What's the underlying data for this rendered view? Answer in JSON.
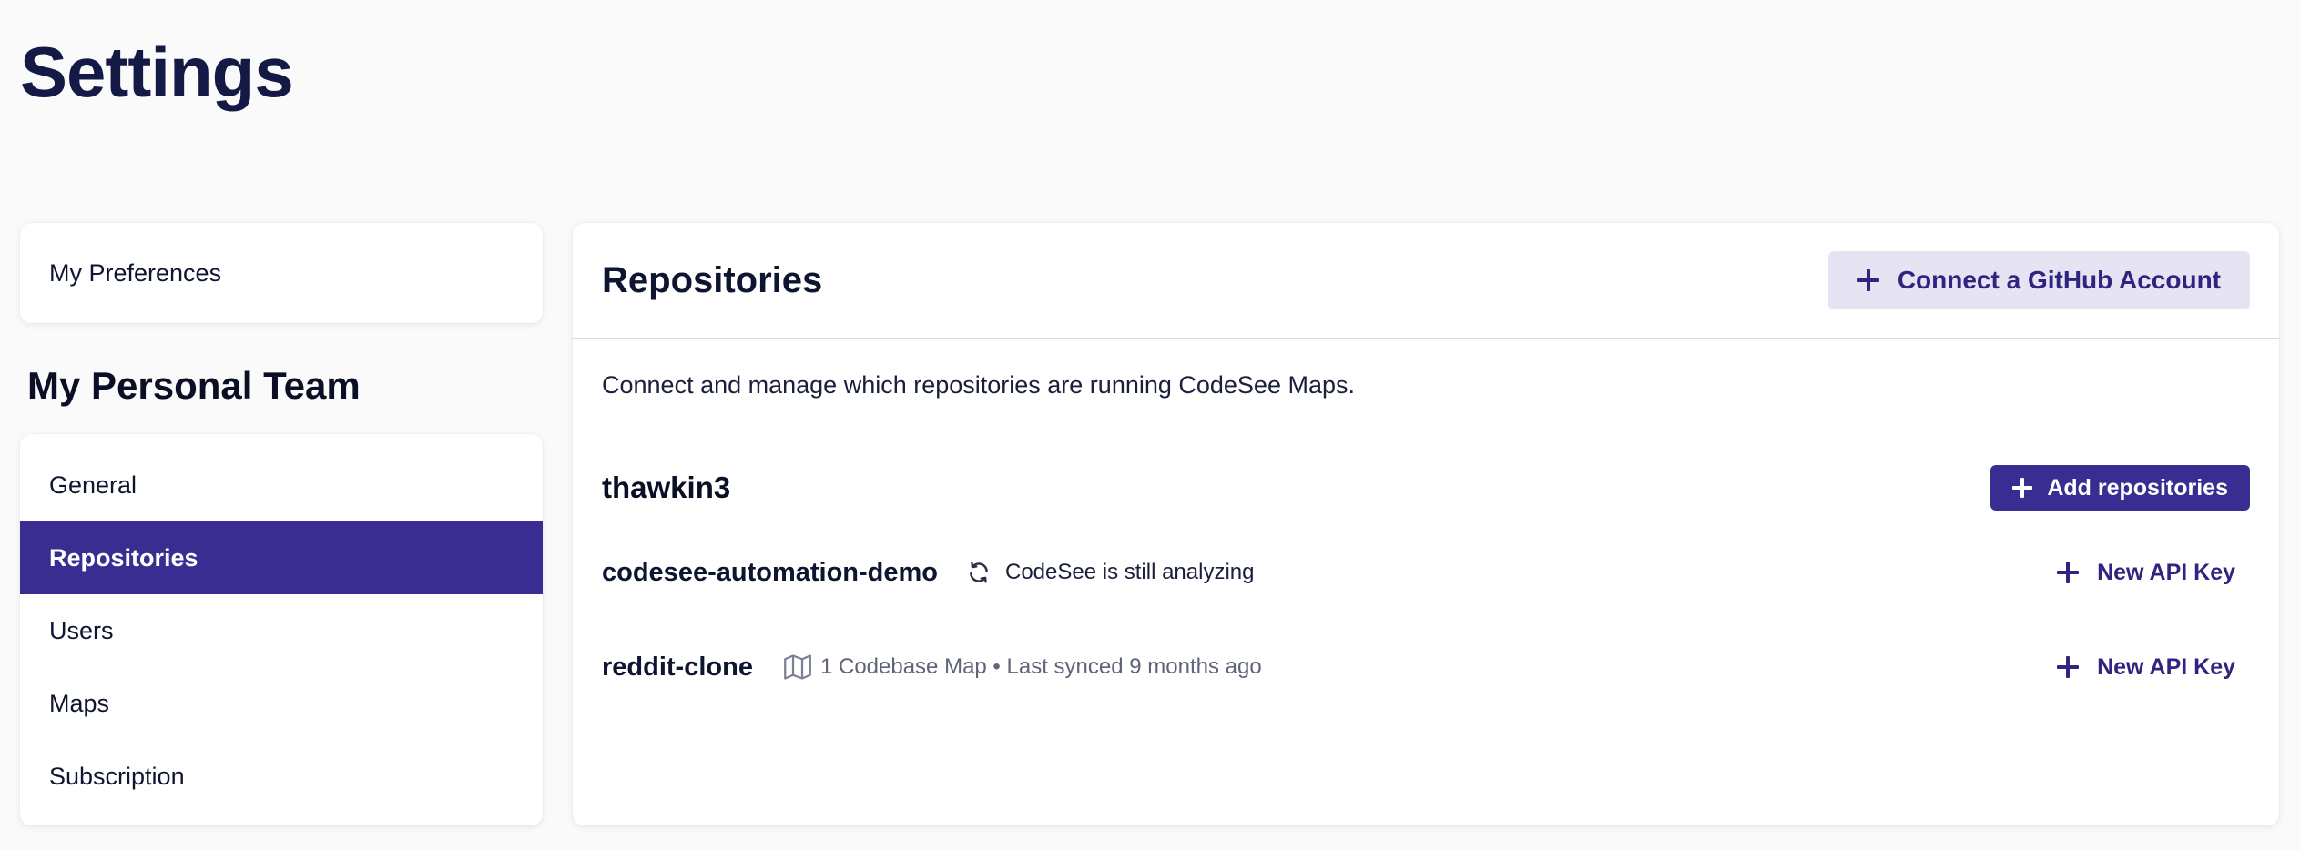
{
  "page": {
    "title": "Settings"
  },
  "sidebar": {
    "preferences_label": "My Preferences",
    "team_title": "My Personal Team",
    "team_items": [
      {
        "label": "General",
        "active": false
      },
      {
        "label": "Repositories",
        "active": true
      },
      {
        "label": "Users",
        "active": false
      },
      {
        "label": "Maps",
        "active": false
      },
      {
        "label": "Subscription",
        "active": false
      }
    ]
  },
  "main": {
    "title": "Repositories",
    "connect_button_label": "Connect a GitHub Account",
    "description": "Connect and manage which repositories are running CodeSee Maps.",
    "owner": {
      "name": "thawkin3",
      "add_button_label": "Add repositories"
    },
    "repositories": [
      {
        "name": "codesee-automation-demo",
        "status_icon": "refresh-icon",
        "status_text": "CodeSee is still analyzing",
        "action_label": "New API Key"
      },
      {
        "name": "reddit-clone",
        "status_icon": "map-icon",
        "status_text": "1 Codebase Map • Last synced 9 months ago",
        "action_label": "New API Key"
      }
    ]
  },
  "colors": {
    "accent": "#392d92",
    "accent_light": "#e6e4f2",
    "heading": "#141a45",
    "background": "#fafafa"
  }
}
